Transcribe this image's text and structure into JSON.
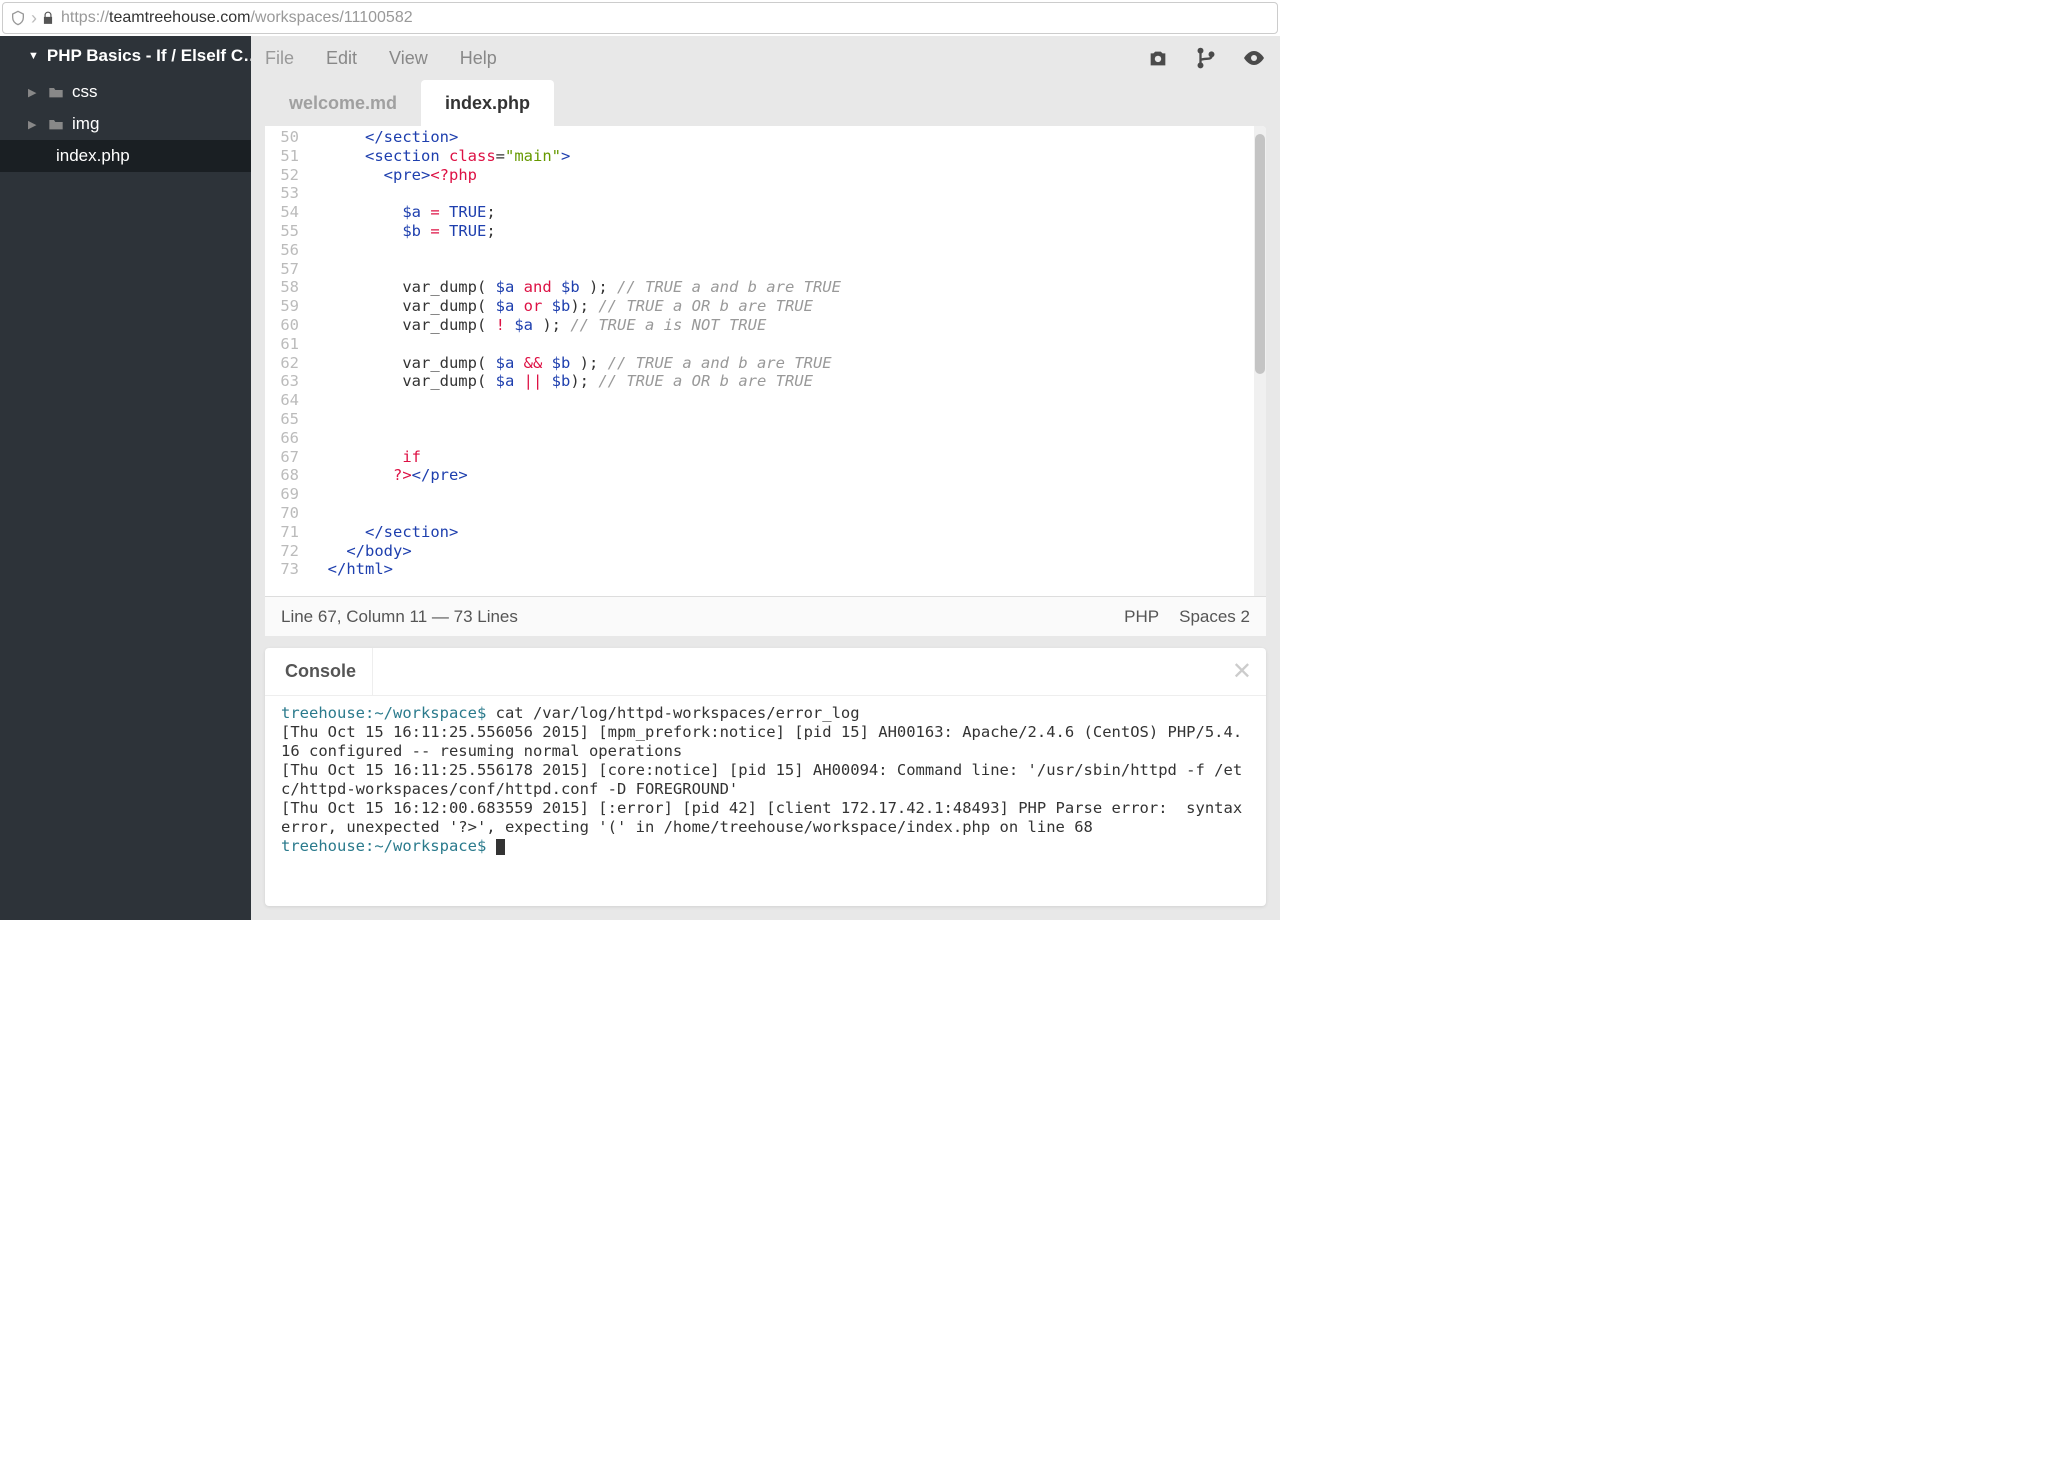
{
  "browser": {
    "url_prefix": "https://",
    "url_host": "teamtreehouse.com",
    "url_path": "/workspaces/11100582"
  },
  "sidebar": {
    "project_title": "PHP Basics - If / ElseIf C…",
    "items": [
      {
        "label": "css",
        "type": "folder"
      },
      {
        "label": "img",
        "type": "folder"
      },
      {
        "label": "index.php",
        "type": "file",
        "active": true
      }
    ]
  },
  "menubar": {
    "items": [
      "File",
      "Edit",
      "View",
      "Help"
    ]
  },
  "tabs": [
    {
      "label": "welcome.md",
      "active": false
    },
    {
      "label": "index.php",
      "active": true
    }
  ],
  "editor": {
    "first_line_no": 50,
    "lines": [
      {
        "n": 50,
        "segments": [
          {
            "t": "      ",
            "c": ""
          },
          {
            "t": "</section>",
            "c": "c-tag"
          }
        ]
      },
      {
        "n": 51,
        "segments": [
          {
            "t": "      ",
            "c": ""
          },
          {
            "t": "<section",
            "c": "c-tag"
          },
          {
            "t": " ",
            "c": ""
          },
          {
            "t": "class",
            "c": "c-attr"
          },
          {
            "t": "=",
            "c": ""
          },
          {
            "t": "\"main\"",
            "c": "c-str"
          },
          {
            "t": ">",
            "c": "c-tag"
          }
        ]
      },
      {
        "n": 52,
        "segments": [
          {
            "t": "        ",
            "c": ""
          },
          {
            "t": "<pre>",
            "c": "c-tag"
          },
          {
            "t": "<?php",
            "c": "c-key"
          }
        ]
      },
      {
        "n": 53,
        "segments": []
      },
      {
        "n": 54,
        "segments": [
          {
            "t": "          ",
            "c": ""
          },
          {
            "t": "$a",
            "c": "c-var"
          },
          {
            "t": " ",
            "c": ""
          },
          {
            "t": "=",
            "c": "c-op"
          },
          {
            "t": " ",
            "c": ""
          },
          {
            "t": "TRUE",
            "c": "c-bool"
          },
          {
            "t": ";",
            "c": ""
          }
        ]
      },
      {
        "n": 55,
        "segments": [
          {
            "t": "          ",
            "c": ""
          },
          {
            "t": "$b",
            "c": "c-var"
          },
          {
            "t": " ",
            "c": ""
          },
          {
            "t": "=",
            "c": "c-op"
          },
          {
            "t": " ",
            "c": ""
          },
          {
            "t": "TRUE",
            "c": "c-bool"
          },
          {
            "t": ";",
            "c": ""
          }
        ]
      },
      {
        "n": 56,
        "segments": []
      },
      {
        "n": 57,
        "segments": []
      },
      {
        "n": 58,
        "segments": [
          {
            "t": "          var_dump( ",
            "c": ""
          },
          {
            "t": "$a",
            "c": "c-var"
          },
          {
            "t": " ",
            "c": ""
          },
          {
            "t": "and",
            "c": "c-op"
          },
          {
            "t": " ",
            "c": ""
          },
          {
            "t": "$b",
            "c": "c-var"
          },
          {
            "t": " ); ",
            "c": ""
          },
          {
            "t": "// TRUE a and b are TRUE",
            "c": "c-comment"
          }
        ]
      },
      {
        "n": 59,
        "segments": [
          {
            "t": "          var_dump( ",
            "c": ""
          },
          {
            "t": "$a",
            "c": "c-var"
          },
          {
            "t": " ",
            "c": ""
          },
          {
            "t": "or",
            "c": "c-op"
          },
          {
            "t": " ",
            "c": ""
          },
          {
            "t": "$b",
            "c": "c-var"
          },
          {
            "t": "); ",
            "c": ""
          },
          {
            "t": "// TRUE a OR b are TRUE",
            "c": "c-comment"
          }
        ]
      },
      {
        "n": 60,
        "segments": [
          {
            "t": "          var_dump( ",
            "c": ""
          },
          {
            "t": "!",
            "c": "c-op"
          },
          {
            "t": " ",
            "c": ""
          },
          {
            "t": "$a",
            "c": "c-var"
          },
          {
            "t": " ); ",
            "c": ""
          },
          {
            "t": "// TRUE a is NOT TRUE",
            "c": "c-comment"
          }
        ]
      },
      {
        "n": 61,
        "segments": []
      },
      {
        "n": 62,
        "segments": [
          {
            "t": "          var_dump( ",
            "c": ""
          },
          {
            "t": "$a",
            "c": "c-var"
          },
          {
            "t": " ",
            "c": ""
          },
          {
            "t": "&&",
            "c": "c-op"
          },
          {
            "t": " ",
            "c": ""
          },
          {
            "t": "$b",
            "c": "c-var"
          },
          {
            "t": " ); ",
            "c": ""
          },
          {
            "t": "// TRUE a and b are TRUE",
            "c": "c-comment"
          }
        ]
      },
      {
        "n": 63,
        "segments": [
          {
            "t": "          var_dump( ",
            "c": ""
          },
          {
            "t": "$a",
            "c": "c-var"
          },
          {
            "t": " ",
            "c": ""
          },
          {
            "t": "||",
            "c": "c-op"
          },
          {
            "t": " ",
            "c": ""
          },
          {
            "t": "$b",
            "c": "c-var"
          },
          {
            "t": "); ",
            "c": ""
          },
          {
            "t": "// TRUE a OR b are TRUE",
            "c": "c-comment"
          }
        ]
      },
      {
        "n": 64,
        "segments": []
      },
      {
        "n": 65,
        "segments": []
      },
      {
        "n": 66,
        "segments": []
      },
      {
        "n": 67,
        "segments": [
          {
            "t": "          ",
            "c": ""
          },
          {
            "t": "if",
            "c": "c-key"
          }
        ]
      },
      {
        "n": 68,
        "segments": [
          {
            "t": "         ",
            "c": ""
          },
          {
            "t": "?>",
            "c": "c-key"
          },
          {
            "t": "</pre>",
            "c": "c-tag"
          }
        ]
      },
      {
        "n": 69,
        "segments": []
      },
      {
        "n": 70,
        "segments": []
      },
      {
        "n": 71,
        "segments": [
          {
            "t": "      ",
            "c": ""
          },
          {
            "t": "</section>",
            "c": "c-tag"
          }
        ]
      },
      {
        "n": 72,
        "segments": [
          {
            "t": "    ",
            "c": ""
          },
          {
            "t": "</body>",
            "c": "c-tag"
          }
        ]
      },
      {
        "n": 73,
        "segments": [
          {
            "t": "  ",
            "c": ""
          },
          {
            "t": "</html>",
            "c": "c-tag"
          }
        ]
      }
    ]
  },
  "statusbar": {
    "left": "Line 67, Column 11 — 73 Lines",
    "lang": "PHP",
    "indent": "Spaces  2"
  },
  "console": {
    "title": "Console",
    "prompt": "treehouse:~/workspace$",
    "lines": [
      {
        "prompt": true,
        "cmd": " cat /var/log/httpd-workspaces/error_log"
      },
      {
        "text": "[Thu Oct 15 16:11:25.556056 2015] [mpm_prefork:notice] [pid 15] AH00163: Apache/2.4.6 (CentOS) PHP/5.4.16 configured -- resuming normal operations"
      },
      {
        "text": "[Thu Oct 15 16:11:25.556178 2015] [core:notice] [pid 15] AH00094: Command line: '/usr/sbin/httpd -f /etc/httpd-workspaces/conf/httpd.conf -D FOREGROUND'"
      },
      {
        "text": "[Thu Oct 15 16:12:00.683559 2015] [:error] [pid 42] [client 172.17.42.1:48493] PHP Parse error:  syntax error, unexpected '?>', expecting '(' in /home/treehouse/workspace/index.php on line 68"
      },
      {
        "prompt": true,
        "cmd": " ",
        "cursor": true
      }
    ]
  }
}
